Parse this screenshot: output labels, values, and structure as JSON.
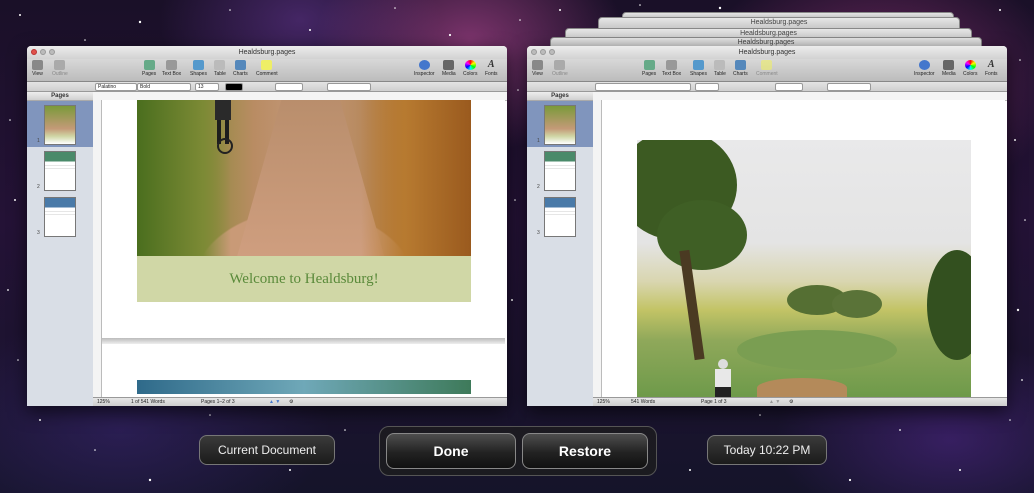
{
  "left_window": {
    "title": "Healdsburg.pages",
    "toolbar_left": [
      "View",
      "Outline"
    ],
    "toolbar_center": [
      "Pages",
      "Text Box",
      "Shapes",
      "Table",
      "Charts",
      "Comment"
    ],
    "toolbar_right": [
      "Inspector",
      "Media",
      "Colors",
      "Fonts"
    ],
    "format": {
      "font": "Palatino",
      "style": "Bold",
      "size": "13"
    },
    "sidebar_header": "Pages",
    "page_numbers": [
      "1",
      "2",
      "3"
    ],
    "welcome_text": "Welcome to Healdsburg!",
    "status": {
      "zoom": "125%",
      "words": "1 of 541 Words",
      "pages": "Pages 1–2 of 3"
    }
  },
  "right_window": {
    "title": "Healdsburg.pages",
    "stack_titles": [
      "Healdsburg.pages",
      "Healdsburg.pages",
      "Healdsburg.pages"
    ],
    "toolbar_left": [
      "View",
      "Outline"
    ],
    "toolbar_center": [
      "Pages",
      "Text Box",
      "Shapes",
      "Table",
      "Charts",
      "Comment"
    ],
    "toolbar_right": [
      "Inspector",
      "Media",
      "Colors",
      "Fonts"
    ],
    "sidebar_header": "Pages",
    "page_numbers": [
      "1",
      "2",
      "3"
    ],
    "status": {
      "zoom": "125%",
      "words": "541 Words",
      "pages": "Page 1 of 3"
    }
  },
  "bottom": {
    "current_document": "Current Document",
    "done": "Done",
    "restore": "Restore",
    "timestamp": "Today 10:22 PM"
  }
}
